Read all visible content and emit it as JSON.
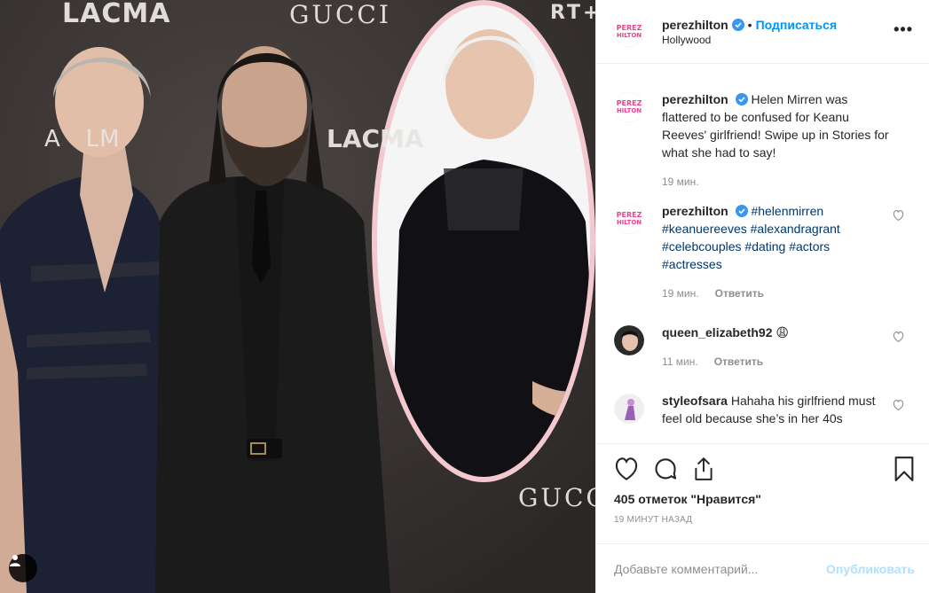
{
  "media": {
    "brand_texts": [
      "LACMA",
      "GUCCI",
      "LACMA",
      "A   LM",
      "GUCCI",
      "RT+"
    ],
    "user_tag_icon": "person-icon"
  },
  "header": {
    "username": "perezhilton",
    "verified_icon": "verified-badge-icon",
    "separator": "•",
    "follow_label": "Подписаться",
    "location": "Hollywood",
    "more_icon": "more-options-icon",
    "more_label": "•••"
  },
  "comments": [
    {
      "username": "perezhilton",
      "verified": true,
      "text": "Helen Mirren was flattered to be confused for Keanu Reeves' girlfriend! Swipe up in Stories for what she had to say!",
      "time": "19 мин.",
      "reply": ""
    },
    {
      "username": "perezhilton",
      "verified": true,
      "hashtags": [
        "#helenmirren",
        "#keanuereeves",
        "#alexandragrant",
        "#celebcouples",
        "#dating",
        "#actors",
        "#actresses"
      ],
      "time": "19 мин.",
      "reply": "Ответить"
    },
    {
      "username": "queen_elizabeth92",
      "text": "😩",
      "time": "11 мин.",
      "reply": "Ответить"
    },
    {
      "username": "styleofsara",
      "text": "Hahaha his girlfriend must feel old because she’s in her 40s",
      "time": "",
      "reply": ""
    }
  ],
  "actions": {
    "like_icon": "heart-icon",
    "comment_icon": "comment-icon",
    "share_icon": "share-icon",
    "save_icon": "bookmark-icon",
    "likes": "405 отметок \"Нравится\"",
    "time_ago": "19 минут назад"
  },
  "add_comment": {
    "placeholder": "Добавьте комментарий...",
    "publish_label": "Опубликовать"
  },
  "colors": {
    "link_blue": "#0095f6",
    "hashtag_blue": "#00376b",
    "muted": "#8e8e8e",
    "publish_disabled": "#b2dffc",
    "perez_pink": "#e8458a"
  }
}
